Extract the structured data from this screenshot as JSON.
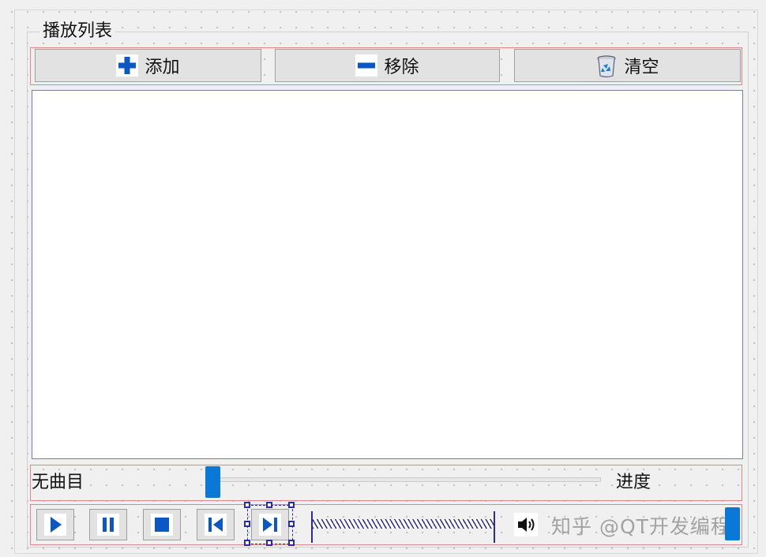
{
  "playlist": {
    "title": "播放列表",
    "buttons": {
      "add": {
        "label": "添加",
        "icon": "plus-icon"
      },
      "remove": {
        "label": "移除",
        "icon": "minus-icon"
      },
      "clear": {
        "label": "清空",
        "icon": "recycle-bin-icon"
      }
    },
    "items": []
  },
  "progress": {
    "current_track": "无曲目",
    "label": "进度",
    "value_fraction": 0.0
  },
  "controls": {
    "buttons": [
      {
        "name": "play-button",
        "icon": "play-icon"
      },
      {
        "name": "pause-button",
        "icon": "pause-icon"
      },
      {
        "name": "stop-button",
        "icon": "stop-icon"
      },
      {
        "name": "previous-button",
        "icon": "skip-previous-icon"
      },
      {
        "name": "next-button",
        "icon": "skip-next-icon",
        "selected_in_designer": true
      }
    ],
    "volume_icon": "speaker-icon",
    "volume_fraction": 1.0
  },
  "watermark": "知乎 @QT开发编程",
  "colors": {
    "accent": "#0a78d7",
    "icon_blue": "#0b57c4",
    "layout_border": "#e08585",
    "designer_selection": "#2a2ab0"
  }
}
